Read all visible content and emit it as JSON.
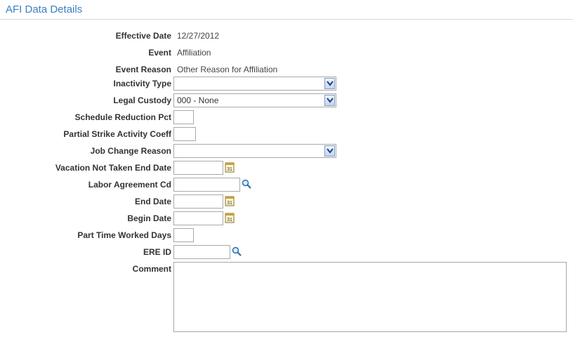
{
  "page": {
    "title": "AFI Data Details"
  },
  "fields": {
    "effective_date": {
      "label": "Effective Date",
      "value": "12/27/2012"
    },
    "event": {
      "label": "Event",
      "value": "Affiliation"
    },
    "event_reason": {
      "label": "Event Reason",
      "value": "Other Reason for Affiliation"
    },
    "inactivity_type": {
      "label": "Inactivity Type",
      "value": ""
    },
    "legal_custody": {
      "label": "Legal Custody",
      "value": "000 - None"
    },
    "schedule_reduction_pct": {
      "label": "Schedule Reduction Pct",
      "value": ""
    },
    "partial_strike_activity_coeff": {
      "label": "Partial Strike Activity Coeff",
      "value": ""
    },
    "job_change_reason": {
      "label": "Job Change Reason",
      "value": ""
    },
    "vacation_not_taken_end_date": {
      "label": "Vacation Not Taken End Date",
      "value": ""
    },
    "labor_agreement_cd": {
      "label": "Labor Agreement Cd",
      "value": ""
    },
    "end_date": {
      "label": "End Date",
      "value": ""
    },
    "begin_date": {
      "label": "Begin Date",
      "value": ""
    },
    "part_time_worked_days": {
      "label": "Part Time Worked Days",
      "value": ""
    },
    "ere_id": {
      "label": "ERE ID",
      "value": ""
    },
    "comment": {
      "label": "Comment",
      "value": ""
    }
  },
  "icons": {
    "calendar": "calendar-icon",
    "lookup": "magnifier-lookup-icon",
    "dropdown": "chevron-down-icon"
  },
  "colors": {
    "title": "#3b7fc4",
    "field_border": "#a9a9a9"
  }
}
